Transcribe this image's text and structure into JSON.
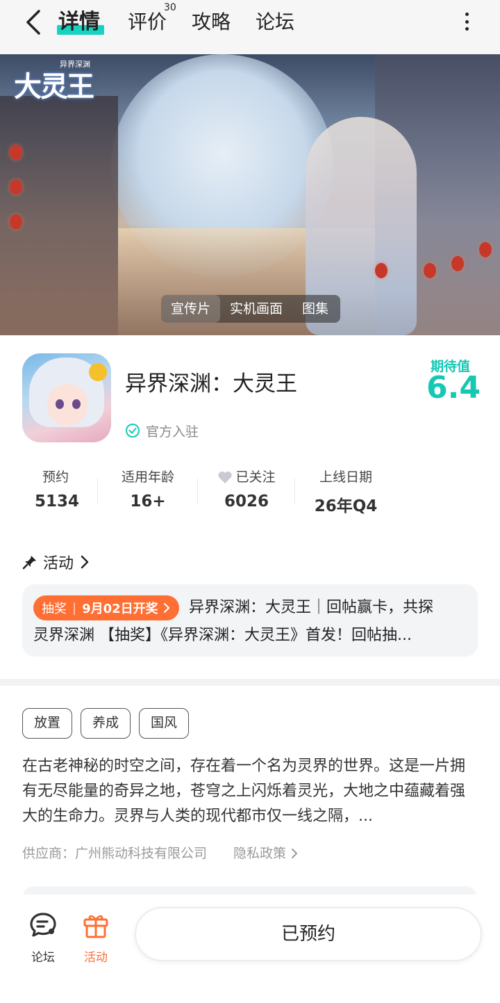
{
  "nav": {
    "tabs": [
      "详情",
      "评价",
      "攻略",
      "论坛"
    ],
    "review_count": "30"
  },
  "banner": {
    "logo_text": "大灵王",
    "logo_sub": "异界深渊",
    "media_tabs": [
      "宣传片",
      "实机画面",
      "图集"
    ]
  },
  "game": {
    "name": "异界深渊：大灵王",
    "official_label": "官方入驻",
    "expect_label": "期待值",
    "expect_value": "6.4"
  },
  "stats": [
    {
      "label": "预约",
      "value": "5134"
    },
    {
      "label": "适用年龄",
      "value": "16+"
    },
    {
      "label": "已关注",
      "value": "6026"
    },
    {
      "label": "上线日期",
      "value": "26年Q4"
    }
  ],
  "activity": {
    "title": "活动",
    "badge_type": "抽奖",
    "badge_date": "9月02日开奖",
    "line1": "异界深渊：大灵王｜回帖赢卡，共探",
    "line2": "灵界深渊 【抽奖】《异界深渊：大灵王》首发！回帖抽..."
  },
  "tags": [
    "放置",
    "养成",
    "国风"
  ],
  "description": "在古老神秘的时空之间，存在着一个名为灵界的世界。这是一片拥有无尽能量的奇异之地，苍穹之上闪烁着灵光，大地之中蕴藏着强大的生命力。灵界与人类的现代都市仅一线之隔，...",
  "supplier": "供应商：广州熊动科技有限公司",
  "privacy": "隐私政策",
  "bottom": {
    "forum_label": "论坛",
    "activity_label": "活动",
    "reserve_label": "已预约"
  },
  "colors": {
    "accent": "#16d2c0",
    "orange": "#ff6e33"
  }
}
